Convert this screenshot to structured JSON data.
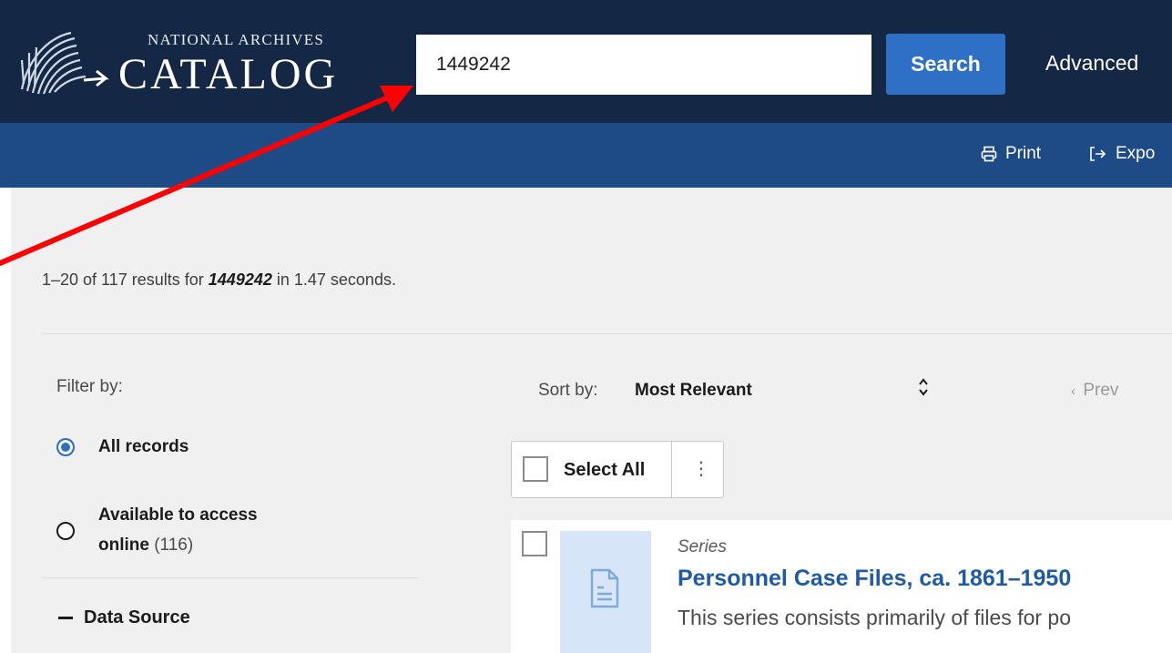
{
  "header": {
    "logo_small": "NATIONAL ARCHIVES",
    "logo_big": "CATALOG",
    "search_value": "1449242",
    "search_label": "Search",
    "advanced_label": "Advanced"
  },
  "toolbar": {
    "print_label": "Print",
    "export_label": "Expo"
  },
  "results": {
    "summary_prefix": "1–20 of 117 results for ",
    "summary_query": "1449242",
    "summary_suffix": " in 1.47 seconds."
  },
  "filters": {
    "label": "Filter by:",
    "all_records": "All records",
    "available_line1": "Available to access",
    "available_line2": "online",
    "available_count": "(116)",
    "data_source": "Data Source"
  },
  "sort": {
    "label": "Sort by:",
    "value": "Most Relevant",
    "prev_label": "Prev"
  },
  "bulk": {
    "select_all": "Select All"
  },
  "result_item": {
    "type": "Series",
    "title": "Personnel Case Files, ca. 1861–1950",
    "description": "This series consists primarily of files for po"
  },
  "colors": {
    "header_bg": "#142845",
    "toolbar_bg": "#1e4a86",
    "accent": "#2d70c6",
    "link": "#1e5aa6",
    "annotation_arrow": "#ff0000"
  },
  "icons": [
    "logo-mark-icon",
    "printer-icon",
    "export-icon",
    "sort-arrows-icon",
    "kebab-menu-icon",
    "document-icon",
    "chevron-left-icon"
  ]
}
